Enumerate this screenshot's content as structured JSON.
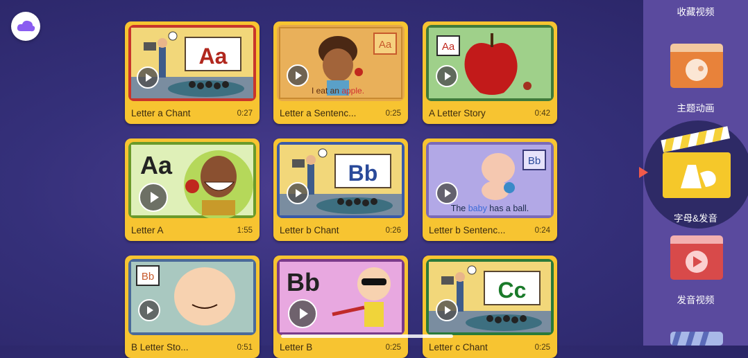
{
  "videos": [
    {
      "title": "Letter a Chant",
      "duration": "0:27"
    },
    {
      "title": "Letter a Sentenc...",
      "duration": "0:25",
      "caption": "I eat an ",
      "caption_highlight": "apple."
    },
    {
      "title": "A Letter Story",
      "duration": "0:42"
    },
    {
      "title": "Letter A",
      "duration": "1:55"
    },
    {
      "title": "Letter b Chant",
      "duration": "0:26"
    },
    {
      "title": "Letter b Sentenc...",
      "duration": "0:24",
      "caption": "The ",
      "caption_highlight": "baby",
      "caption_end": " has a ball."
    },
    {
      "title": "B Letter Sto...",
      "duration": "0:51"
    },
    {
      "title": "Letter B",
      "duration": "0:25"
    },
    {
      "title": "Letter c Chant",
      "duration": "0:25"
    }
  ],
  "letters": {
    "aa": "Aa",
    "bb": "Bb",
    "cc": "Cc"
  },
  "sidebar": {
    "items": [
      {
        "label": "收藏视频"
      },
      {
        "label": "主题动画"
      },
      {
        "label": "字母&发音",
        "active": true
      },
      {
        "label": "发音视频"
      }
    ]
  },
  "icons": {
    "back": "cloud-back-icon",
    "play": "play-icon"
  },
  "colors": {
    "card": "#f7c431",
    "active_pointer": "#f05a4a",
    "background": "#35307a",
    "sidebar": "#5a4a9e"
  }
}
